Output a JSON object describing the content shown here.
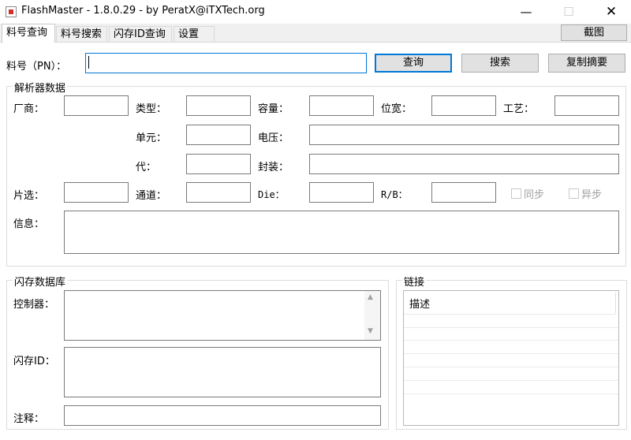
{
  "window": {
    "title": "FlashMaster - 1.8.0.29 - by PeratX@iTXTech.org",
    "minimize_glyph": "—",
    "maximize_glyph": "☐",
    "close_glyph": "✕"
  },
  "tabs": [
    {
      "label": "料号查询",
      "active": true
    },
    {
      "label": "料号搜索",
      "active": false
    },
    {
      "label": "闪存ID查询",
      "active": false
    },
    {
      "label": "设置",
      "active": false
    }
  ],
  "screenshot_button": "截图",
  "search": {
    "label": "料号（PN）：",
    "value": "",
    "query_button": "查询",
    "search_button": "搜索",
    "copy_summary_button": "复制摘要"
  },
  "decoder": {
    "title": "解析器数据",
    "vendor": "厂商：",
    "type": "类型：",
    "capacity": "容量：",
    "width": "位宽：",
    "process": "工艺：",
    "cell": "单元：",
    "voltage": "电压：",
    "generation": "代：",
    "package": "封装：",
    "ce": "片选：",
    "channel": "通道：",
    "die": "Die：",
    "rb": "R/B：",
    "sync": "同步",
    "async": "异步",
    "info": "信息："
  },
  "flash_db": {
    "title": "闪存数据库",
    "controller": "控制器：",
    "flash_id": "闪存ID：",
    "comment": "注释："
  },
  "links": {
    "title": "链接",
    "column_description": "描述",
    "rows": 6
  },
  "colors": {
    "accent": "#0078d7",
    "border": "#7a7a7a",
    "button_bg": "#e1e1e1"
  }
}
